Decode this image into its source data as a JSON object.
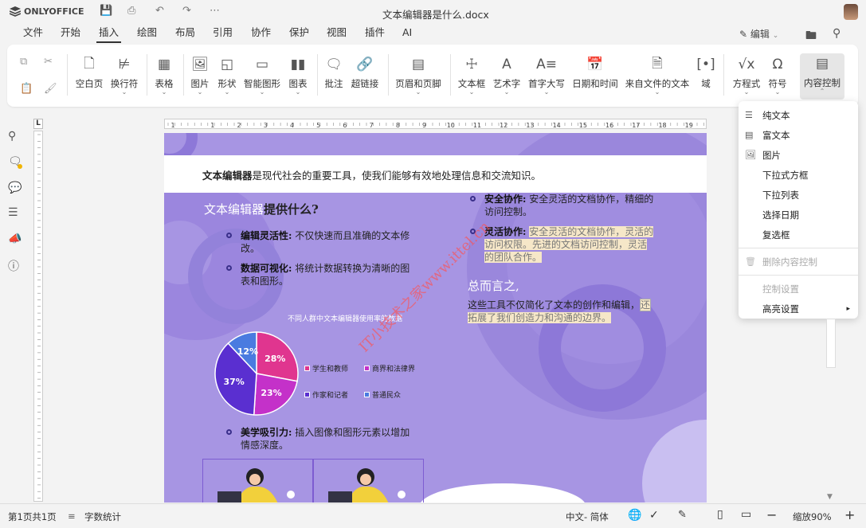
{
  "app": {
    "brand": "ONLYOFFICE",
    "doc_title": "文本编辑器是什么.docx"
  },
  "menu": [
    "文件",
    "开始",
    "插入",
    "绘图",
    "布局",
    "引用",
    "协作",
    "保护",
    "视图",
    "插件",
    "AI"
  ],
  "active_menu": "插入",
  "edit_mode": "编辑",
  "ribbon": {
    "blank_page": "空白页",
    "line_break": "换行符",
    "table": "表格",
    "image": "图片",
    "shape": "形状",
    "smart_art": "智能图形",
    "chart": "图表",
    "comment": "批注",
    "hyperlink": "超链接",
    "header_footer": "页眉和页脚",
    "textbox": "文本框",
    "art_text": "艺术字",
    "drop_cap": "首字大写",
    "date_time": "日期和时间",
    "from_file": "来自文件的文本",
    "field": "域",
    "equation": "方程式",
    "symbol": "符号",
    "content_control": "内容控制"
  },
  "document": {
    "intro_bold": "文本编辑器",
    "intro_rest": "是现代社会的重要工具，使我们能够有效地处理信息和交流知识。",
    "heading_a": "文本编辑器",
    "heading_b": "提供什么?",
    "b1_title": "编辑灵活性:",
    "b1_l1": "不仅快速而且准确的文本修",
    "b1_l2": "改。",
    "b2_title": "数据可视化:",
    "b2_l1": "将统计数据转换为清晰的图",
    "b2_l2": "表和图形。",
    "b3_title": "美学吸引力:",
    "b3_l1": "插入图像和图形元素以增加",
    "b3_l2": "情感深度。",
    "r1_title": "安全协作:",
    "r1_l1": "安全灵活的文档协作，精细的",
    "r1_l2": "访问控制。",
    "r2_title": "灵活协作:",
    "r2_l1": "安全灵活的文档协作，灵活的",
    "r2_l2": "访问权限。先进的文档访问控制，灵活",
    "r2_l3": "的团队合作。",
    "conclusion_heading": "总而言之,",
    "conclusion_l1": "这些工具不仅简化了文本的创作和编辑，",
    "conclusion_l1_end": "还",
    "conclusion_l2": "拓展了我们创造力和沟通的边界。",
    "watermark": "IT小技术之家www.ittel.cn"
  },
  "chart_data": {
    "type": "pie",
    "title": "不同人群中文本编辑器使用率的数据",
    "categories": [
      "学生和教师",
      "商界和法律界",
      "作家和记者",
      "普通民众"
    ],
    "values": [
      28,
      23,
      37,
      12
    ],
    "labels": [
      "28%",
      "23%",
      "37%",
      "12%"
    ],
    "colors": [
      "#e0358f",
      "#c431c9",
      "#5a2fd0",
      "#4a7be0"
    ],
    "legend_position": "right"
  },
  "dropdown": {
    "items": [
      "纯文本",
      "富文本",
      "图片",
      "下拉式方框",
      "下拉列表",
      "选择日期",
      "复选框"
    ],
    "delete": "删除内容控制",
    "settings": "控制设置",
    "highlight": "高亮设置"
  },
  "ruler": {
    "h_ticks": [
      "1",
      "1",
      "2",
      "3",
      "4",
      "5",
      "6",
      "7",
      "8",
      "9",
      "10",
      "11",
      "12",
      "13",
      "14",
      "15",
      "16",
      "17",
      "18",
      "19"
    ]
  },
  "status": {
    "page": "第1页共1页",
    "word_count": "字数统计",
    "language": "中文- 简体",
    "zoom": "缩放90%"
  }
}
